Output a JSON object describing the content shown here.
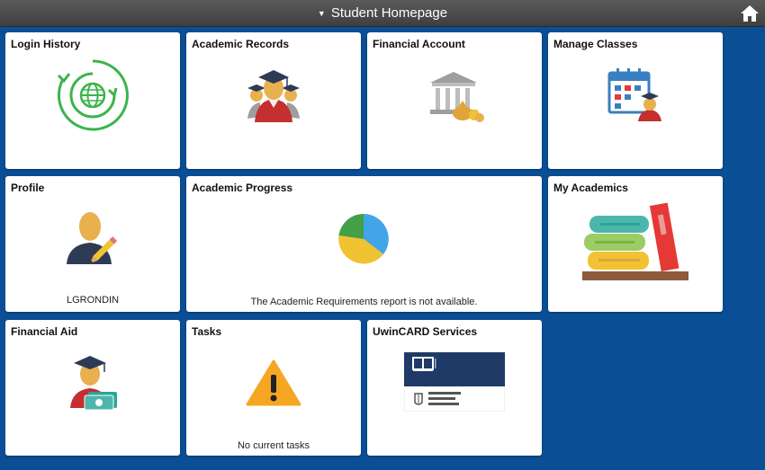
{
  "header": {
    "title": "Student Homepage",
    "home_icon": "home-icon"
  },
  "tiles": {
    "login_history": {
      "title": "Login History",
      "icon": "globe-refresh-icon"
    },
    "academic_records": {
      "title": "Academic Records",
      "icon": "graduates-icon"
    },
    "financial_account": {
      "title": "Financial Account",
      "icon": "bank-money-icon"
    },
    "manage_classes": {
      "title": "Manage Classes",
      "icon": "calendar-student-icon"
    },
    "profile": {
      "title": "Profile",
      "icon": "person-pencil-icon",
      "footer": "LGRONDIN"
    },
    "academic_progress": {
      "title": "Academic Progress",
      "icon": "pie-chart-icon",
      "footer": "The Academic Requirements report is not available."
    },
    "my_academics": {
      "title": "My Academics",
      "icon": "books-icon"
    },
    "financial_aid": {
      "title": "Financial Aid",
      "icon": "graduate-money-icon"
    },
    "tasks": {
      "title": "Tasks",
      "icon": "warning-icon",
      "footer": "No current tasks"
    },
    "uwincard": {
      "title": "UwinCARD Services",
      "icon": "uwincard-logo-icon"
    }
  },
  "colors": {
    "background": "#0a4f96",
    "topbar": "#4a4a4a"
  }
}
